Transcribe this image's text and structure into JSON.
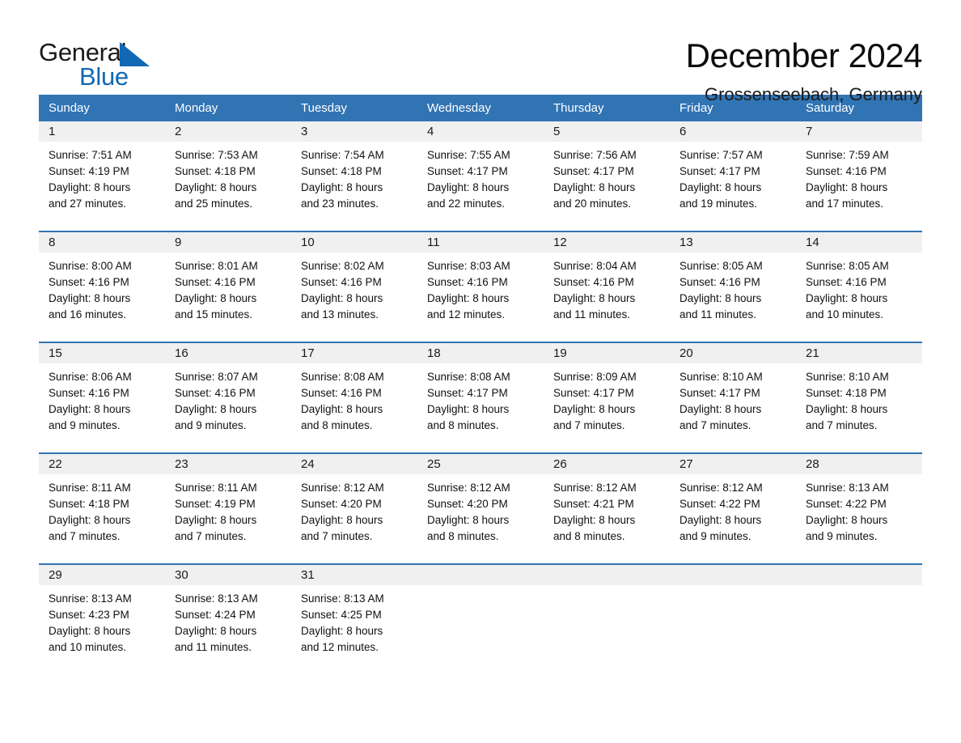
{
  "logo": {
    "word_one": "General",
    "word_two": "Blue",
    "triangle_color": "#1168b3"
  },
  "header": {
    "title": "December 2024",
    "location": "Grossenseebach, Germany",
    "accent_color": "#3174b4"
  },
  "calendar": {
    "weekdays": [
      "Sunday",
      "Monday",
      "Tuesday",
      "Wednesday",
      "Thursday",
      "Friday",
      "Saturday"
    ],
    "weeks": [
      [
        {
          "day": "1",
          "sunrise": "Sunrise: 7:51 AM",
          "sunset": "Sunset: 4:19 PM",
          "daylight_line1": "Daylight: 8 hours",
          "daylight_line2": "and 27 minutes."
        },
        {
          "day": "2",
          "sunrise": "Sunrise: 7:53 AM",
          "sunset": "Sunset: 4:18 PM",
          "daylight_line1": "Daylight: 8 hours",
          "daylight_line2": "and 25 minutes."
        },
        {
          "day": "3",
          "sunrise": "Sunrise: 7:54 AM",
          "sunset": "Sunset: 4:18 PM",
          "daylight_line1": "Daylight: 8 hours",
          "daylight_line2": "and 23 minutes."
        },
        {
          "day": "4",
          "sunrise": "Sunrise: 7:55 AM",
          "sunset": "Sunset: 4:17 PM",
          "daylight_line1": "Daylight: 8 hours",
          "daylight_line2": "and 22 minutes."
        },
        {
          "day": "5",
          "sunrise": "Sunrise: 7:56 AM",
          "sunset": "Sunset: 4:17 PM",
          "daylight_line1": "Daylight: 8 hours",
          "daylight_line2": "and 20 minutes."
        },
        {
          "day": "6",
          "sunrise": "Sunrise: 7:57 AM",
          "sunset": "Sunset: 4:17 PM",
          "daylight_line1": "Daylight: 8 hours",
          "daylight_line2": "and 19 minutes."
        },
        {
          "day": "7",
          "sunrise": "Sunrise: 7:59 AM",
          "sunset": "Sunset: 4:16 PM",
          "daylight_line1": "Daylight: 8 hours",
          "daylight_line2": "and 17 minutes."
        }
      ],
      [
        {
          "day": "8",
          "sunrise": "Sunrise: 8:00 AM",
          "sunset": "Sunset: 4:16 PM",
          "daylight_line1": "Daylight: 8 hours",
          "daylight_line2": "and 16 minutes."
        },
        {
          "day": "9",
          "sunrise": "Sunrise: 8:01 AM",
          "sunset": "Sunset: 4:16 PM",
          "daylight_line1": "Daylight: 8 hours",
          "daylight_line2": "and 15 minutes."
        },
        {
          "day": "10",
          "sunrise": "Sunrise: 8:02 AM",
          "sunset": "Sunset: 4:16 PM",
          "daylight_line1": "Daylight: 8 hours",
          "daylight_line2": "and 13 minutes."
        },
        {
          "day": "11",
          "sunrise": "Sunrise: 8:03 AM",
          "sunset": "Sunset: 4:16 PM",
          "daylight_line1": "Daylight: 8 hours",
          "daylight_line2": "and 12 minutes."
        },
        {
          "day": "12",
          "sunrise": "Sunrise: 8:04 AM",
          "sunset": "Sunset: 4:16 PM",
          "daylight_line1": "Daylight: 8 hours",
          "daylight_line2": "and 11 minutes."
        },
        {
          "day": "13",
          "sunrise": "Sunrise: 8:05 AM",
          "sunset": "Sunset: 4:16 PM",
          "daylight_line1": "Daylight: 8 hours",
          "daylight_line2": "and 11 minutes."
        },
        {
          "day": "14",
          "sunrise": "Sunrise: 8:05 AM",
          "sunset": "Sunset: 4:16 PM",
          "daylight_line1": "Daylight: 8 hours",
          "daylight_line2": "and 10 minutes."
        }
      ],
      [
        {
          "day": "15",
          "sunrise": "Sunrise: 8:06 AM",
          "sunset": "Sunset: 4:16 PM",
          "daylight_line1": "Daylight: 8 hours",
          "daylight_line2": "and 9 minutes."
        },
        {
          "day": "16",
          "sunrise": "Sunrise: 8:07 AM",
          "sunset": "Sunset: 4:16 PM",
          "daylight_line1": "Daylight: 8 hours",
          "daylight_line2": "and 9 minutes."
        },
        {
          "day": "17",
          "sunrise": "Sunrise: 8:08 AM",
          "sunset": "Sunset: 4:16 PM",
          "daylight_line1": "Daylight: 8 hours",
          "daylight_line2": "and 8 minutes."
        },
        {
          "day": "18",
          "sunrise": "Sunrise: 8:08 AM",
          "sunset": "Sunset: 4:17 PM",
          "daylight_line1": "Daylight: 8 hours",
          "daylight_line2": "and 8 minutes."
        },
        {
          "day": "19",
          "sunrise": "Sunrise: 8:09 AM",
          "sunset": "Sunset: 4:17 PM",
          "daylight_line1": "Daylight: 8 hours",
          "daylight_line2": "and 7 minutes."
        },
        {
          "day": "20",
          "sunrise": "Sunrise: 8:10 AM",
          "sunset": "Sunset: 4:17 PM",
          "daylight_line1": "Daylight: 8 hours",
          "daylight_line2": "and 7 minutes."
        },
        {
          "day": "21",
          "sunrise": "Sunrise: 8:10 AM",
          "sunset": "Sunset: 4:18 PM",
          "daylight_line1": "Daylight: 8 hours",
          "daylight_line2": "and 7 minutes."
        }
      ],
      [
        {
          "day": "22",
          "sunrise": "Sunrise: 8:11 AM",
          "sunset": "Sunset: 4:18 PM",
          "daylight_line1": "Daylight: 8 hours",
          "daylight_line2": "and 7 minutes."
        },
        {
          "day": "23",
          "sunrise": "Sunrise: 8:11 AM",
          "sunset": "Sunset: 4:19 PM",
          "daylight_line1": "Daylight: 8 hours",
          "daylight_line2": "and 7 minutes."
        },
        {
          "day": "24",
          "sunrise": "Sunrise: 8:12 AM",
          "sunset": "Sunset: 4:20 PM",
          "daylight_line1": "Daylight: 8 hours",
          "daylight_line2": "and 7 minutes."
        },
        {
          "day": "25",
          "sunrise": "Sunrise: 8:12 AM",
          "sunset": "Sunset: 4:20 PM",
          "daylight_line1": "Daylight: 8 hours",
          "daylight_line2": "and 8 minutes."
        },
        {
          "day": "26",
          "sunrise": "Sunrise: 8:12 AM",
          "sunset": "Sunset: 4:21 PM",
          "daylight_line1": "Daylight: 8 hours",
          "daylight_line2": "and 8 minutes."
        },
        {
          "day": "27",
          "sunrise": "Sunrise: 8:12 AM",
          "sunset": "Sunset: 4:22 PM",
          "daylight_line1": "Daylight: 8 hours",
          "daylight_line2": "and 9 minutes."
        },
        {
          "day": "28",
          "sunrise": "Sunrise: 8:13 AM",
          "sunset": "Sunset: 4:22 PM",
          "daylight_line1": "Daylight: 8 hours",
          "daylight_line2": "and 9 minutes."
        }
      ],
      [
        {
          "day": "29",
          "sunrise": "Sunrise: 8:13 AM",
          "sunset": "Sunset: 4:23 PM",
          "daylight_line1": "Daylight: 8 hours",
          "daylight_line2": "and 10 minutes."
        },
        {
          "day": "30",
          "sunrise": "Sunrise: 8:13 AM",
          "sunset": "Sunset: 4:24 PM",
          "daylight_line1": "Daylight: 8 hours",
          "daylight_line2": "and 11 minutes."
        },
        {
          "day": "31",
          "sunrise": "Sunrise: 8:13 AM",
          "sunset": "Sunset: 4:25 PM",
          "daylight_line1": "Daylight: 8 hours",
          "daylight_line2": "and 12 minutes."
        },
        {
          "day": "",
          "sunrise": "",
          "sunset": "",
          "daylight_line1": "",
          "daylight_line2": ""
        },
        {
          "day": "",
          "sunrise": "",
          "sunset": "",
          "daylight_line1": "",
          "daylight_line2": ""
        },
        {
          "day": "",
          "sunrise": "",
          "sunset": "",
          "daylight_line1": "",
          "daylight_line2": ""
        },
        {
          "day": "",
          "sunrise": "",
          "sunset": "",
          "daylight_line1": "",
          "daylight_line2": ""
        }
      ]
    ]
  }
}
